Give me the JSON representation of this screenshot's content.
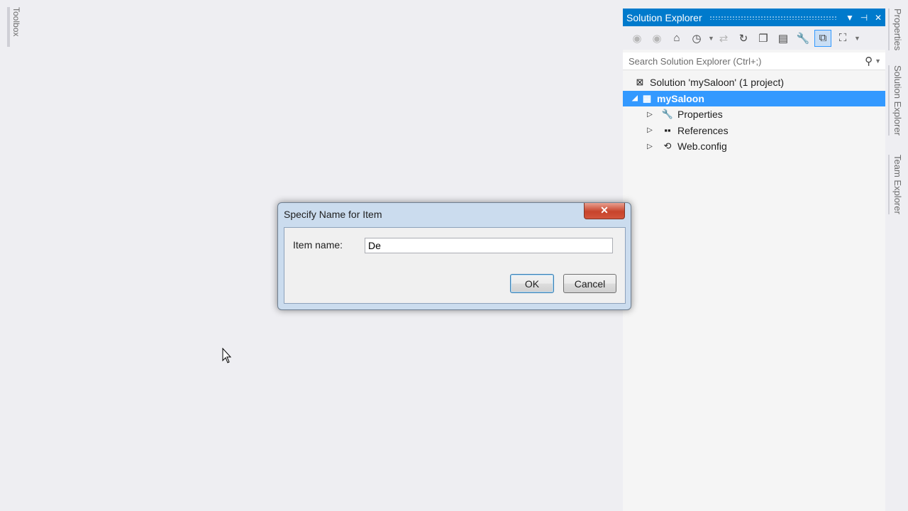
{
  "toolbox": {
    "label": "Toolbox"
  },
  "solution_explorer": {
    "title": "Solution Explorer",
    "search_placeholder": "Search Solution Explorer (Ctrl+;)",
    "tree": {
      "solution": "Solution 'mySaloon' (1 project)",
      "project": "mySaloon",
      "items": [
        "Properties",
        "References",
        "Web.config"
      ]
    }
  },
  "right_tabs": [
    "Properties",
    "Solution Explorer",
    "Team Explorer"
  ],
  "dialog": {
    "title": "Specify Name for Item",
    "close_label": "✕",
    "item_name_label": "Item name:",
    "item_name_value": "De",
    "ok_label": "OK",
    "cancel_label": "Cancel"
  },
  "colors": {
    "accent": "#007acc",
    "selection": "#3399ff"
  }
}
